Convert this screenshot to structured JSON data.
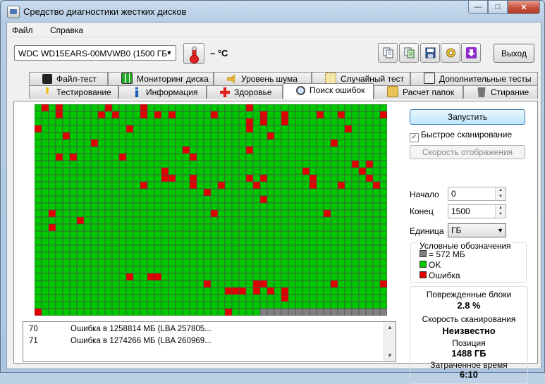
{
  "window": {
    "title": "Средство диагностики жестких дисков",
    "min": "—",
    "max": "□",
    "close": "✕"
  },
  "menu": [
    {
      "label": "Файл"
    },
    {
      "label": "Справка"
    }
  ],
  "toolbar": {
    "drive": "WDC WD15EARS-00MVWB0    (1500 ГБ",
    "temperature": "– °C",
    "exit_label": "Выход",
    "icons": [
      "copy-icon",
      "copy-green-icon",
      "save-icon",
      "settings-icon",
      "download-icon"
    ]
  },
  "tabs_row1": [
    {
      "label": "Файл-тест",
      "icon": "file-test-icon"
    },
    {
      "label": "Мониторинг диска",
      "icon": "chart-icon"
    },
    {
      "label": "Уровень шума",
      "icon": "speaker-icon"
    },
    {
      "label": "Случайный тест",
      "icon": "dice-icon"
    },
    {
      "label": "Дополнительные тесты",
      "icon": "calculator-icon"
    }
  ],
  "tabs_row2": [
    {
      "label": "Тестирование",
      "icon": "exclamation-icon"
    },
    {
      "label": "Информация",
      "icon": "info-icon"
    },
    {
      "label": "Здоровье",
      "icon": "health-cross-icon"
    },
    {
      "label": "Поиск ошибок",
      "icon": "magnifier-icon",
      "active": true
    },
    {
      "label": "Расчет папок",
      "icon": "folder-icon"
    },
    {
      "label": "Стирание",
      "icon": "trash-icon"
    }
  ],
  "grid": {
    "cols": 50,
    "rows": 30,
    "colors": {
      "ok": "#00c800",
      "error": "#e00000",
      "pending": "#808080",
      "line": "#4a4a4a"
    },
    "error_blocks": [
      [
        0,
        1
      ],
      [
        0,
        3
      ],
      [
        0,
        10
      ],
      [
        0,
        15
      ],
      [
        0,
        30
      ],
      [
        1,
        3
      ],
      [
        1,
        9
      ],
      [
        1,
        11
      ],
      [
        1,
        15
      ],
      [
        1,
        17
      ],
      [
        1,
        19
      ],
      [
        1,
        25
      ],
      [
        1,
        32
      ],
      [
        1,
        35
      ],
      [
        1,
        40
      ],
      [
        1,
        43
      ],
      [
        1,
        49
      ],
      [
        2,
        32
      ],
      [
        2,
        30
      ],
      [
        2,
        35
      ],
      [
        3,
        0
      ],
      [
        3,
        13
      ],
      [
        3,
        30
      ],
      [
        3,
        44
      ],
      [
        4,
        4
      ],
      [
        4,
        33
      ],
      [
        5,
        8
      ],
      [
        5,
        42
      ],
      [
        6,
        21
      ],
      [
        6,
        30
      ],
      [
        7,
        3
      ],
      [
        7,
        5
      ],
      [
        7,
        12
      ],
      [
        7,
        22
      ],
      [
        8,
        45
      ],
      [
        8,
        47
      ],
      [
        9,
        18
      ],
      [
        9,
        38
      ],
      [
        9,
        46
      ],
      [
        10,
        18
      ],
      [
        10,
        19
      ],
      [
        10,
        22
      ],
      [
        10,
        30
      ],
      [
        10,
        32
      ],
      [
        10,
        39
      ],
      [
        10,
        47
      ],
      [
        11,
        15
      ],
      [
        11,
        22
      ],
      [
        11,
        26
      ],
      [
        11,
        31
      ],
      [
        11,
        39
      ],
      [
        11,
        43
      ],
      [
        11,
        48
      ],
      [
        12,
        24
      ],
      [
        13,
        32
      ],
      [
        15,
        2
      ],
      [
        15,
        25
      ],
      [
        15,
        41
      ],
      [
        16,
        6
      ],
      [
        17,
        2
      ],
      [
        24,
        13
      ],
      [
        24,
        16
      ],
      [
        24,
        17
      ],
      [
        25,
        24
      ],
      [
        25,
        31
      ],
      [
        25,
        32
      ],
      [
        25,
        42
      ],
      [
        25,
        49
      ],
      [
        26,
        27
      ],
      [
        26,
        28
      ],
      [
        26,
        29
      ],
      [
        26,
        31
      ],
      [
        26,
        33
      ],
      [
        26,
        35
      ],
      [
        27,
        35
      ],
      [
        29,
        0
      ],
      [
        29,
        27
      ]
    ],
    "pending_start": {
      "row": 29,
      "col": 32
    }
  },
  "log": [
    {
      "num": "70",
      "msg": "Ошибка в 1258814 МБ (LBA 257805..."
    },
    {
      "num": "71",
      "msg": "Ошибка в 1274266 МБ (LBA 260969..."
    }
  ],
  "controls": {
    "run_label": "Запустить",
    "fast_scan_label": "Быстрое сканирование",
    "fast_scan_checked": true,
    "speed_label": "Скорость отображения",
    "start_label": "Начало",
    "start_value": "0",
    "end_label": "Конец",
    "end_value": "1500",
    "unit_label": "Единица",
    "unit_value": "ГБ"
  },
  "legend": {
    "title": "Условные обозначения",
    "block_size": "= 572 МБ",
    "ok": "OK",
    "error": "Ошибка"
  },
  "stats": {
    "damaged_label": "Поврежденные блоки",
    "damaged_value": "2.8 %",
    "speed_label": "Скорость сканирования",
    "speed_value": "Неизвестно",
    "position_label": "Позиция",
    "position_value": "1488 ГБ",
    "elapsed_label": "Затраченное время",
    "elapsed_value": "6:10"
  }
}
